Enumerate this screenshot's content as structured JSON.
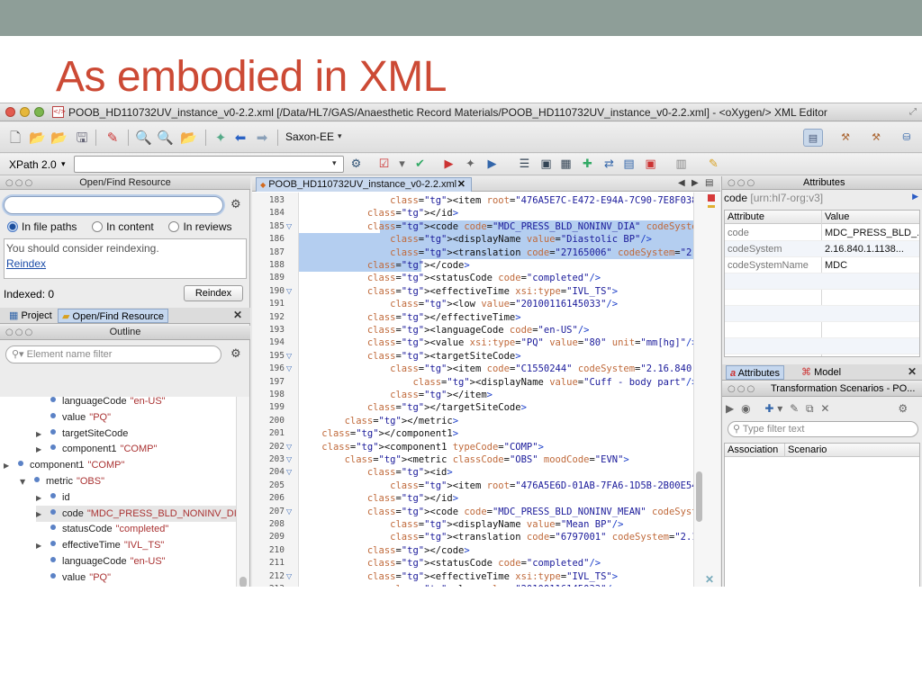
{
  "slide": {
    "title": "As embodied in XML"
  },
  "window": {
    "title": "POOB_HD110732UV_instance_v0-2.2.xml [/Data/HL7/GAS/Anaesthetic Record Materials/POOB_HD110732UV_instance_v0-2.2.xml] - <oXygen/> XML Editor"
  },
  "toolbar": {
    "transformer": "Saxon-EE",
    "xpath_label": "XPath 2.0",
    "xpath_value": ""
  },
  "open_find": {
    "header": "Open/Find Resource",
    "search_value": "",
    "radio_file_paths": "In file paths",
    "radio_content": "In content",
    "radio_reviews": "In reviews",
    "message": "You should consider reindexing.",
    "reindex_link": "Reindex",
    "indexed_label": "Indexed: 0",
    "reindex_button": "Reindex",
    "tab_project": "Project",
    "tab_open_find": "Open/Find Resource"
  },
  "outline": {
    "header": "Outline",
    "filter_placeholder": "Element name filter",
    "rows": [
      {
        "name": "languageCode",
        "val": "\"en-US\""
      },
      {
        "name": "value",
        "val": "\"PQ\""
      },
      {
        "name": "targetSiteCode",
        "val": ""
      },
      {
        "name": "component1",
        "val": "\"COMP\""
      },
      {
        "name": "component1",
        "val": "\"COMP\""
      },
      {
        "name": "metric",
        "val": "\"OBS\""
      },
      {
        "name": "id",
        "val": ""
      },
      {
        "name": "code",
        "val": "\"MDC_PRESS_BLD_NONINV_DIA"
      },
      {
        "name": "statusCode",
        "val": "\"completed\""
      },
      {
        "name": "effectiveTime",
        "val": "\"IVL_TS\""
      },
      {
        "name": "languageCode",
        "val": "\"en-US\""
      },
      {
        "name": "value",
        "val": "\"PQ\""
      },
      {
        "name": "targetSiteCode",
        "val": ""
      },
      {
        "name": "component1",
        "val": "\"COMP\""
      }
    ]
  },
  "editor": {
    "tab_label": "POOB_HD110732UV_instance_v0-2.2.xml",
    "lines": [
      {
        "n": "183",
        "t": "                <item root=\"476A5E7C-E472-E94A-7C90-7E8F038E8429\"/>"
      },
      {
        "n": "184",
        "t": "            </id>"
      },
      {
        "n": "185",
        "t": "            <code code=\"MDC_PRESS_BLD_NONINV_DIA\" codeSystem=\"2.16.8"
      },
      {
        "n": "186",
        "t": "                <displayName value=\"Diastolic BP\"/>"
      },
      {
        "n": "187",
        "t": "                <translation code=\"27165006\" codeSystem=\"2.16.840.1"
      },
      {
        "n": "188",
        "t": "            </code>"
      },
      {
        "n": "189",
        "t": "            <statusCode code=\"completed\"/>"
      },
      {
        "n": "190",
        "t": "            <effectiveTime xsi:type=\"IVL_TS\">"
      },
      {
        "n": "191",
        "t": "                <low value=\"20100116145033\"/>"
      },
      {
        "n": "192",
        "t": "            </effectiveTime>"
      },
      {
        "n": "193",
        "t": "            <languageCode code=\"en-US\"/>"
      },
      {
        "n": "194",
        "t": "            <value xsi:type=\"PQ\" value=\"80\" unit=\"mm[hg]\"/>"
      },
      {
        "n": "195",
        "t": "            <targetSiteCode>"
      },
      {
        "n": "196",
        "t": "                <item code=\"C1550244\" codeSystem=\"2.16.840.1.113883."
      },
      {
        "n": "197",
        "t": "                    <displayName value=\"Cuff - body part\"/>"
      },
      {
        "n": "198",
        "t": "                </item>"
      },
      {
        "n": "199",
        "t": "            </targetSiteCode>"
      },
      {
        "n": "200",
        "t": "        </metric>"
      },
      {
        "n": "201",
        "t": "    </component1>"
      },
      {
        "n": "202",
        "t": "    <component1 typeCode=\"COMP\">"
      },
      {
        "n": "203",
        "t": "        <metric classCode=\"OBS\" moodCode=\"EVN\">"
      },
      {
        "n": "204",
        "t": "            <id>"
      },
      {
        "n": "205",
        "t": "                <item root=\"476A5E6D-01AB-7FA6-1D5B-2B00E5493FED\"/>"
      },
      {
        "n": "206",
        "t": "            </id>"
      },
      {
        "n": "207",
        "t": "            <code code=\"MDC_PRESS_BLD_NONINV_MEAN\" codeSystem=\"2.16."
      },
      {
        "n": "208",
        "t": "                <displayName value=\"Mean BP\"/>"
      },
      {
        "n": "209",
        "t": "                <translation code=\"6797001\" codeSystem=\"2.16.840.1.1"
      },
      {
        "n": "210",
        "t": "            </code>"
      },
      {
        "n": "211",
        "t": "            <statusCode code=\"completed\"/>"
      },
      {
        "n": "212",
        "t": "            <effectiveTime xsi:type=\"IVL_TS\">"
      },
      {
        "n": "213",
        "t": "                <low value=\"20100116145033\"/>"
      }
    ]
  },
  "attributes": {
    "header": "Attributes",
    "element": "code",
    "namespace": "[urn:hl7-org:v3]",
    "col_attribute": "Attribute",
    "col_value": "Value",
    "rows": [
      {
        "name": "code",
        "value": "MDC_PRESS_BLD_..."
      },
      {
        "name": "codeSystem",
        "value": "2.16.840.1.1138..."
      },
      {
        "name": "codeSystemName",
        "value": "MDC"
      }
    ],
    "tab_attributes": "Attributes",
    "tab_model": "Model"
  },
  "scenarios": {
    "header": "Transformation Scenarios - PO...",
    "filter_placeholder": "Type filter text",
    "col_association": "Association",
    "col_scenario": "Scenario"
  }
}
